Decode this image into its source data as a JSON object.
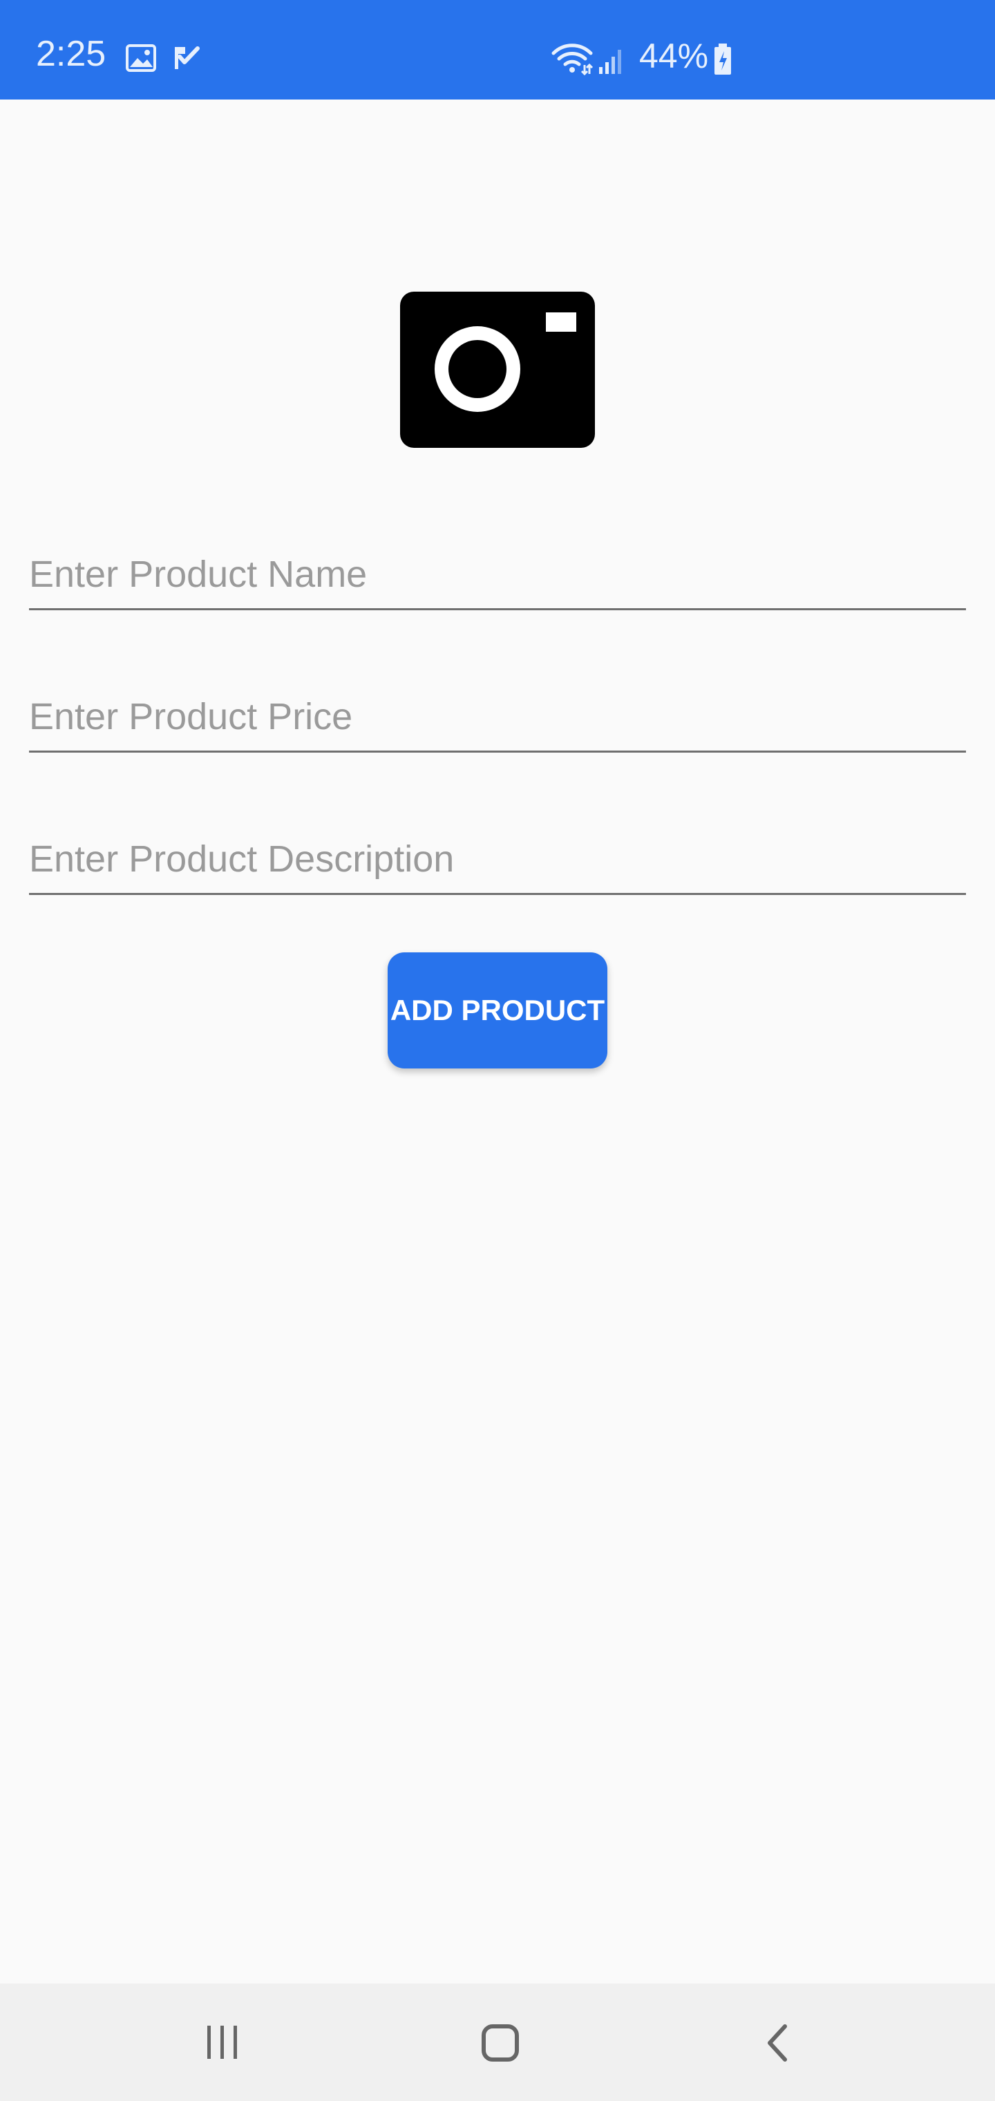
{
  "status_bar": {
    "time": "2:25",
    "battery": "44%",
    "background_color": "#2873ec",
    "icons_left": [
      "gallery-icon",
      "task-check-icon"
    ],
    "icons_right": [
      "wifi-icon",
      "signal-icon",
      "battery-charging-icon"
    ]
  },
  "form": {
    "image_placeholder_icon": "camera-icon",
    "name_placeholder": "Enter Product Name",
    "price_placeholder": "Enter Product Price",
    "description_placeholder": "Enter Product Description",
    "name_value": "",
    "price_value": "",
    "description_value": "",
    "add_button_label": "ADD PRODUCT",
    "accent_color": "#2873ec"
  },
  "navigation": {
    "icons": [
      "recent-apps-icon",
      "home-icon",
      "back-icon"
    ]
  }
}
